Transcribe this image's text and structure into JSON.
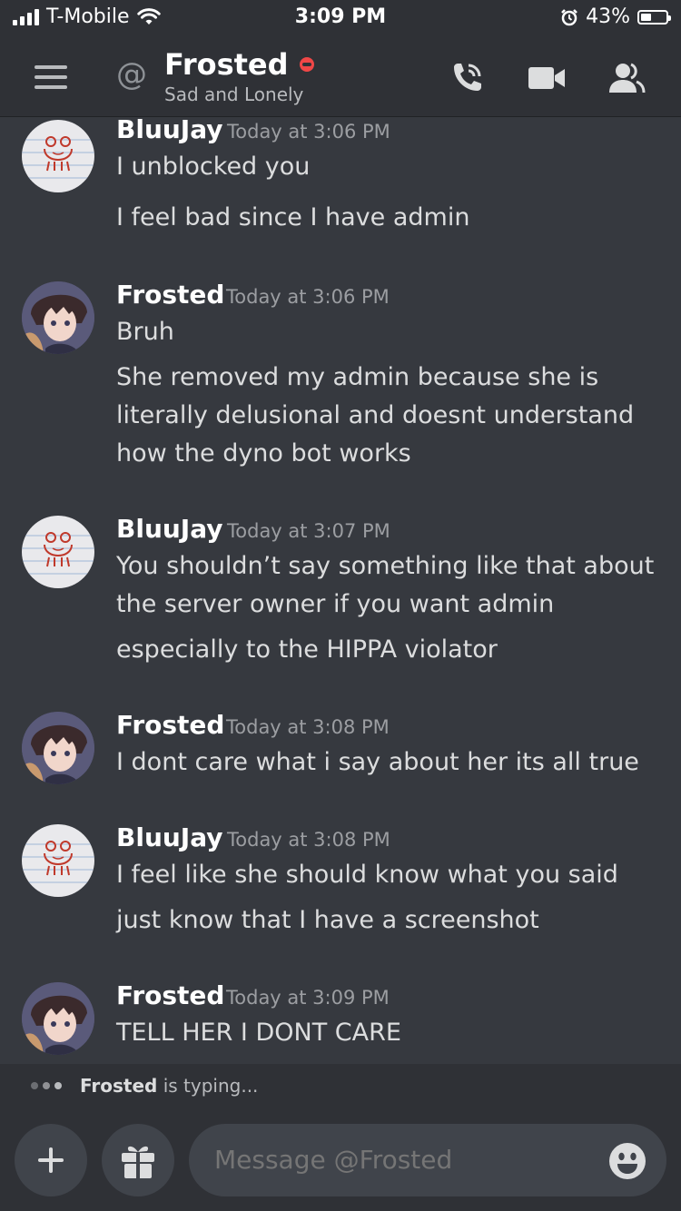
{
  "status_bar": {
    "carrier": "T-Mobile",
    "time": "3:09 PM",
    "battery": "43%",
    "battery_level": 0.43
  },
  "header": {
    "title": "Frosted",
    "subtitle": "Sad and Lonely",
    "status_color": "#f04747",
    "icons": [
      "menu-icon",
      "at-icon",
      "call-icon",
      "video-icon",
      "members-icon"
    ]
  },
  "messages": [
    {
      "author": "BluuJay",
      "timestamp": "Today at 3:06 PM",
      "avatar": "frog-avatar",
      "lines": [
        "I unblocked you",
        "I feel bad since I have admin"
      ]
    },
    {
      "author": "Frosted",
      "timestamp": "Today at 3:06 PM",
      "avatar": "anime-avatar",
      "lines": [
        "Bruh",
        "She removed my admin because she is",
        "literally delusional and doesnt understand",
        "how the dyno bot works"
      ]
    },
    {
      "author": "BluuJay",
      "timestamp": "Today at 3:07 PM",
      "avatar": "frog-avatar",
      "lines": [
        "You shouldn’t say something like that about",
        "the server owner if you want admin",
        "especially to the HIPPA violator"
      ]
    },
    {
      "author": "Frosted",
      "timestamp": "Today at 3:08 PM",
      "avatar": "anime-avatar",
      "lines": [
        "I dont care what i say about her its all true"
      ]
    },
    {
      "author": "BluuJay",
      "timestamp": "Today at 3:08 PM",
      "avatar": "frog-avatar",
      "lines": [
        "I feel like she should know what you said",
        "just know that I have a screenshot"
      ]
    },
    {
      "author": "Frosted",
      "timestamp": "Today at 3:09 PM",
      "avatar": "anime-avatar",
      "lines": [
        "TELL HER I DONT CARE"
      ]
    }
  ],
  "typing": {
    "user": "Frosted",
    "suffix": " is typing..."
  },
  "composer": {
    "placeholder": "Message @Frosted"
  },
  "colors": {
    "background": "#36393f",
    "header_bg": "#2f3136",
    "text": "#dcddde",
    "muted": "#9c9ea2"
  }
}
